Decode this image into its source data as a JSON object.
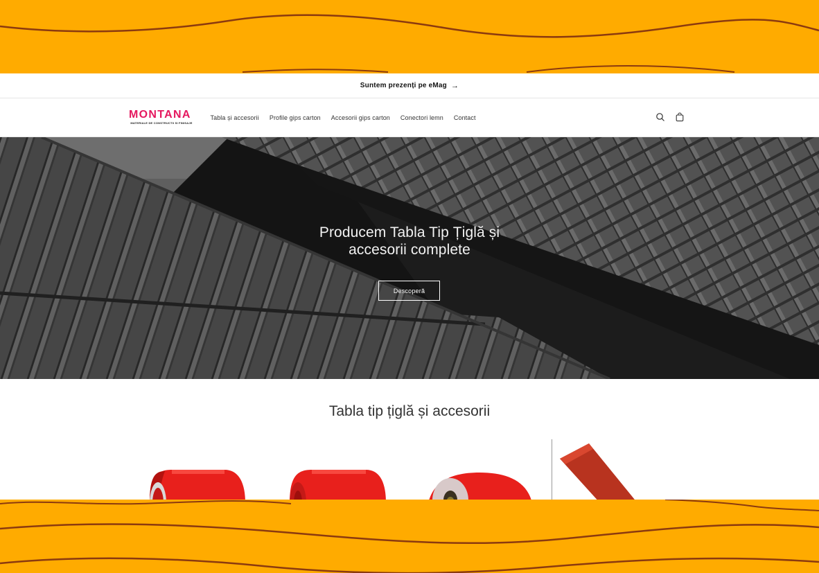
{
  "announcement": {
    "text": "Suntem prezenți pe eMag",
    "arrow": "→"
  },
  "header": {
    "logo": {
      "brand": "MONTANA",
      "tagline": "MATERIALE DE CONSTRUCTII SI FINISAJE"
    },
    "nav": [
      {
        "label": "Tabla și accesorii"
      },
      {
        "label": "Profile gips carton"
      },
      {
        "label": "Accesorii gips carton"
      },
      {
        "label": "Conectori lemn"
      },
      {
        "label": "Contact"
      }
    ],
    "icons": [
      "search-icon",
      "cart-icon"
    ]
  },
  "hero": {
    "line1": "Producem Tabla Tip Țiglă și",
    "line2": "accesorii complete",
    "cta": "Descoperă"
  },
  "collection": {
    "title": "Tabla tip țiglă și accesorii"
  },
  "colors": {
    "brand": "#e5185f",
    "background_band": "#ffab00",
    "band_line": "#8b3a0f",
    "product_red": "#e8201c"
  }
}
